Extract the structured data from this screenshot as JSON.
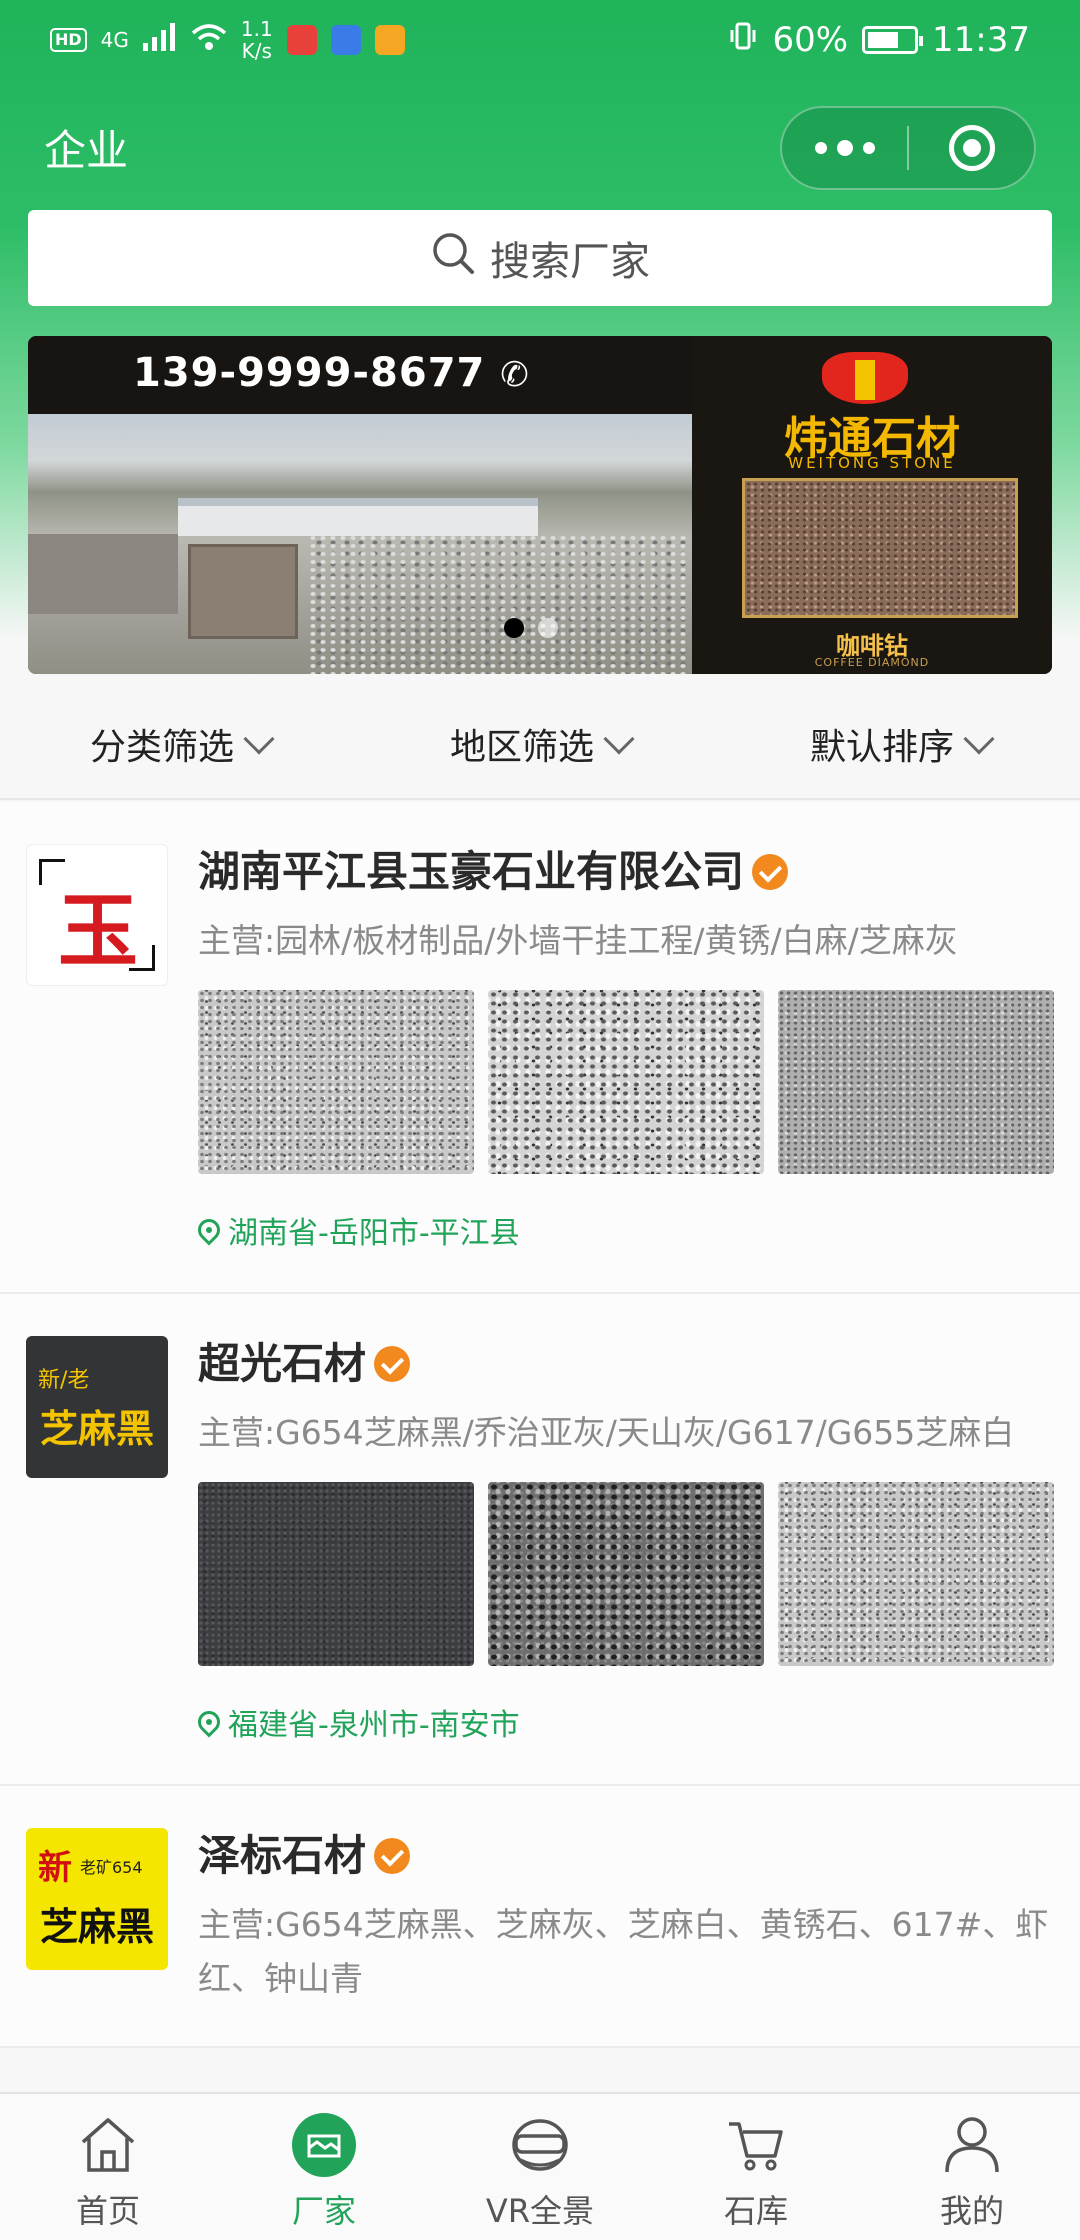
{
  "status_bar": {
    "network_tag": "HD",
    "signal": "4G",
    "speed_value": "1.1",
    "speed_unit": "K/s",
    "battery": "60%",
    "time": "11:37"
  },
  "header": {
    "title": "企业"
  },
  "search": {
    "placeholder": "搜索厂家"
  },
  "banner": {
    "phone": "139-9999-8677",
    "brand_name": "炜通石材",
    "brand_en": "WEITONG STONE",
    "product_cn": "咖啡钻",
    "product_en": "COFFEE DIAMOND"
  },
  "filters": [
    {
      "label": "分类筛选"
    },
    {
      "label": "地区筛选"
    },
    {
      "label": "默认排序"
    }
  ],
  "companies": [
    {
      "name": "湖南平江县玉豪石业有限公司",
      "main_business": "主营:园林/板材制品/外墙干挂工程/黄锈/白麻/芝麻灰",
      "location": "湖南省-岳阳市-平江县",
      "logo_text": "玉"
    },
    {
      "name": "超光石材",
      "main_business": "主营:G654芝麻黑/乔治亚灰/天山灰/G617/G655芝麻白",
      "location": "福建省-泉州市-南安市",
      "logo_line1": "新/老",
      "logo_line2": "芝麻黑"
    },
    {
      "name": "泽标石材",
      "main_business": "主营:G654芝麻黑、芝麻灰、芝麻白、黄锈石、617#、虾红、钟山青",
      "logo_line1": "新",
      "logo_line1b": "老矿654",
      "logo_line2": "芝麻黑"
    }
  ],
  "tabbar": [
    {
      "label": "首页",
      "icon": "home-icon"
    },
    {
      "label": "厂家",
      "icon": "factory-icon"
    },
    {
      "label": "VR全景",
      "icon": "vr-headset-icon"
    },
    {
      "label": "石库",
      "icon": "cart-icon"
    },
    {
      "label": "我的",
      "icon": "user-icon"
    }
  ],
  "colors": {
    "brand_green": "#21a35a",
    "verified_orange": "#f2891e"
  }
}
